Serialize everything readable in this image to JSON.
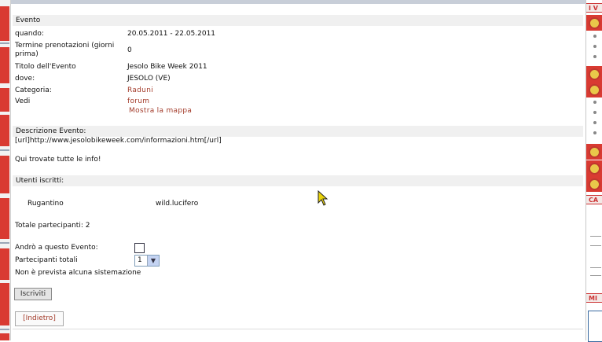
{
  "event_header": "Evento",
  "fields": {
    "quando_label": "quando:",
    "quando_value": "20.05.2011 - 22.05.2011",
    "termine_label": "Termine prenotazioni (giorni prima)",
    "termine_value": "0",
    "titolo_label": "Titolo dell'Evento",
    "titolo_value": "Jesolo Bike Week 2011",
    "dove_label": "dove:",
    "dove_value": "JESOLO (VE)",
    "categoria_label": "Categoria:",
    "categoria_value": "Raduni",
    "vedi_label": "Vedi",
    "vedi_forum": "forum",
    "vedi_mappa": "Mostra la mappa"
  },
  "description": {
    "header": "Descrizione Evento:",
    "line1": "[url]http://www.jesolobikeweek.com/informazioni.htm[/url]",
    "line2": "Qui trovate tutte le info!"
  },
  "subscribers": {
    "header": "Utenti iscritti:",
    "user1": "Rugantino",
    "user2": "wild.lucifero",
    "total": "Totale partecipanti: 2"
  },
  "form": {
    "andro_label": "Andrò a questo Evento:",
    "partecipanti_label": "Partecipanti totali",
    "partecipanti_value": "1",
    "sistemazione": "Non è prevista alcuna sistemazione",
    "iscriviti_button": "Iscriviti",
    "indietro_button": "[Indietro]"
  },
  "right_panel": {
    "head1": "I V",
    "head2": "CA",
    "head3": "MI"
  },
  "colors": {
    "accent_red": "#d93a32",
    "link": "#a33b2a"
  }
}
